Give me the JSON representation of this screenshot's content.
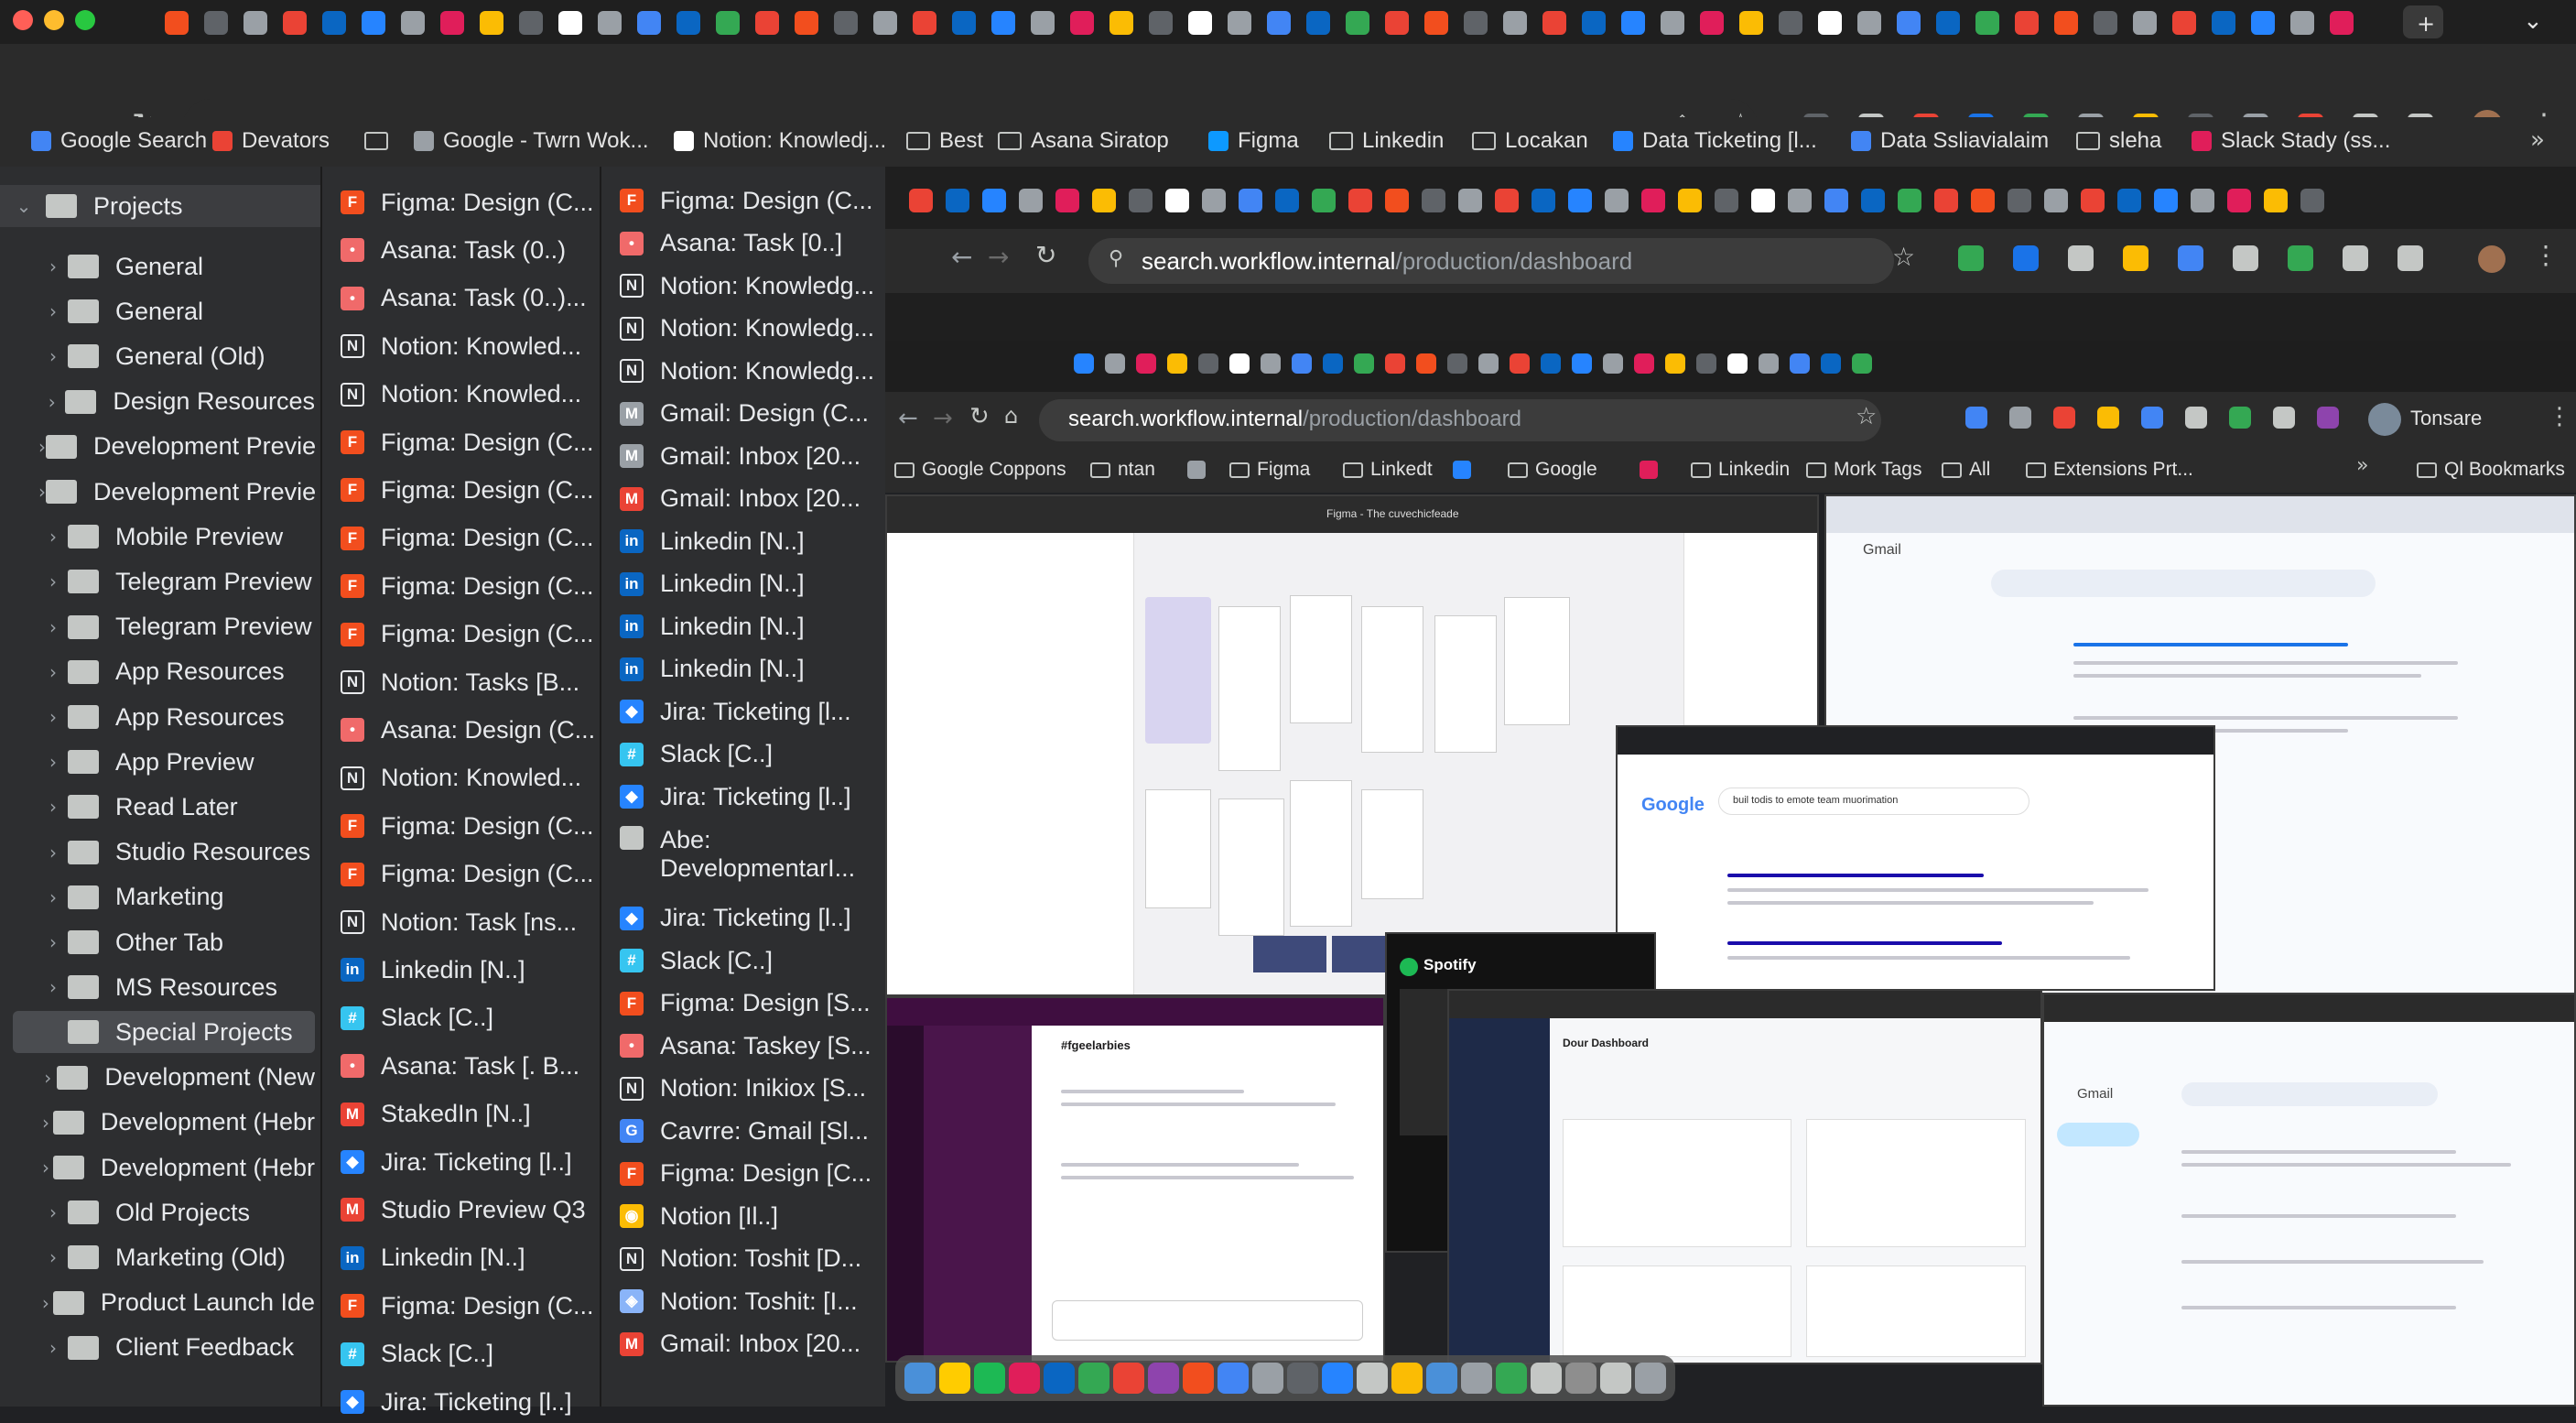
{
  "browser": {
    "address": {
      "host": "search.workflow.internal",
      "path": "/production/dashboard"
    },
    "bookmarks": [
      {
        "label": "Google Search",
        "color": "#4285f4",
        "type": "site"
      },
      {
        "label": "Devators",
        "color": "#ea4335",
        "type": "gmail"
      },
      {
        "label": "",
        "type": "folder"
      },
      {
        "label": "Google - Twrn Wok...",
        "color": "#9aa0a6",
        "type": "site"
      },
      {
        "label": "Notion: Knowledj...",
        "color": "#ffffff",
        "type": "notion"
      },
      {
        "label": "Best",
        "type": "folder"
      },
      {
        "label": "Asana Siratop",
        "type": "folder"
      },
      {
        "label": "Figma",
        "color": "#0d99ff",
        "type": "site"
      },
      {
        "label": "Linkedin",
        "type": "folder"
      },
      {
        "label": "Locakan",
        "type": "folder"
      },
      {
        "label": "Data Ticketing [l...",
        "color": "#2684ff",
        "type": "jira"
      },
      {
        "label": "Data Ssliavialaim",
        "color": "#4285f4",
        "type": "site"
      },
      {
        "label": "sleha",
        "type": "folder"
      },
      {
        "label": "Slack Stady (ss...",
        "color": "#e01e5a",
        "type": "slack"
      }
    ]
  },
  "panel_folders": {
    "header": "Projects",
    "items": [
      "General",
      "General",
      "General (Old)",
      "Design Resources",
      "Development Previe",
      "Development Previe",
      "Mobile Preview",
      "Telegram Preview",
      "Telegram Preview",
      "App Resources",
      "App Resources",
      "App Preview",
      "Read Later",
      "Studio Resources",
      "Marketing",
      "Other Tab",
      "MS Resources",
      "Special Projects",
      "Development (New",
      "Development (Hebr",
      "Development (Hebr",
      "Old Projects",
      "Marketing (Old)",
      "Product Launch Ide",
      "Client Feedback"
    ],
    "selected": "Special Projects"
  },
  "panel_tabs_a": [
    {
      "label": "Figma: Design (C...",
      "icon": "figma"
    },
    {
      "label": "Asana: Task (0..)",
      "icon": "asana"
    },
    {
      "label": "Asana: Task (0..)...",
      "icon": "asana"
    },
    {
      "label": "Notion: Knowled...",
      "icon": "notion"
    },
    {
      "label": "Notion: Knowled...",
      "icon": "notion"
    },
    {
      "label": "Figma: Design (C...",
      "icon": "figma"
    },
    {
      "label": "Figma: Design (C...",
      "icon": "figma"
    },
    {
      "label": "Figma: Design (C...",
      "icon": "figma"
    },
    {
      "label": "Figma: Design (C...",
      "icon": "figma"
    },
    {
      "label": "Figma: Design (C...",
      "icon": "figma"
    },
    {
      "label": "Notion: Tasks [B...",
      "icon": "notion"
    },
    {
      "label": "Asana: Design (C...",
      "icon": "asana"
    },
    {
      "label": "Notion: Knowled...",
      "icon": "notion"
    },
    {
      "label": "Figma: Design (C...",
      "icon": "figma"
    },
    {
      "label": "Figma: Design (C...",
      "icon": "figma"
    },
    {
      "label": "Notion: Task [ns...",
      "icon": "notion"
    },
    {
      "label": "Linkedin [N..]",
      "icon": "linkedin"
    },
    {
      "label": "Slack [C..]",
      "icon": "slack"
    },
    {
      "label": "Asana: Task [. B...",
      "icon": "asana"
    },
    {
      "label": "StakedIn [N..]",
      "icon": "gmail"
    },
    {
      "label": "Jira: Ticketing [l..]",
      "icon": "jira"
    },
    {
      "label": "Studio Preview Q3",
      "icon": "gmail"
    },
    {
      "label": "Linkedin [N..]",
      "icon": "linkedin"
    },
    {
      "label": "Figma: Design (C...",
      "icon": "figma"
    },
    {
      "label": "Slack [C..]",
      "icon": "slack"
    },
    {
      "label": "Jira: Ticketing [l..]",
      "icon": "jira"
    }
  ],
  "panel_tabs_b": [
    {
      "label": "Figma: Design (C...",
      "icon": "figma"
    },
    {
      "label": "Asana: Task [0..]",
      "icon": "asana"
    },
    {
      "label": "Notion: Knowledg...",
      "icon": "notion"
    },
    {
      "label": "Notion: Knowledg...",
      "icon": "notion"
    },
    {
      "label": "Notion: Knowledg...",
      "icon": "notion"
    },
    {
      "label": "Gmail: Design (C...",
      "icon": "gmail-dark"
    },
    {
      "label": "Gmail: Inbox [20...",
      "icon": "gmail-dark"
    },
    {
      "label": "Gmail: Inbox [20...",
      "icon": "gmail"
    },
    {
      "label": "Linkedin [N..]",
      "icon": "linkedin"
    },
    {
      "label": "Linkedin [N..]",
      "icon": "linkedin"
    },
    {
      "label": "Linkedin [N..]",
      "icon": "linkedin"
    },
    {
      "label": "Linkedin [N..]",
      "icon": "linkedin"
    },
    {
      "label": "Jira: Ticketing [l...",
      "icon": "jira"
    },
    {
      "label": "Slack [C..]",
      "icon": "slack"
    },
    {
      "label": "Jira: Ticketing [l..]",
      "icon": "jira"
    },
    {
      "label": "Abe: DevelopmentarI...",
      "icon": "folder"
    },
    {
      "label": "Jira: Ticketing [l..]",
      "icon": "jira"
    },
    {
      "label": "Slack [C..]",
      "icon": "slack"
    },
    {
      "label": "Figma: Design [S...",
      "icon": "figma"
    },
    {
      "label": "Asana: Taskey [S...",
      "icon": "asana"
    },
    {
      "label": "Notion: Inikiox [S...",
      "icon": "notion"
    },
    {
      "label": "Cavrre: Gmail [Sl...",
      "icon": "google"
    },
    {
      "label": "Figma: Design [C...",
      "icon": "figma"
    },
    {
      "label": "Notion [Il..]",
      "icon": "chrome"
    },
    {
      "label": "Notion: Toshit [D...",
      "icon": "notion"
    },
    {
      "label": "Notion: Toshit: [I...",
      "icon": "shield"
    },
    {
      "label": "Gmail: Inbox [20...",
      "icon": "gmail"
    }
  ],
  "inner_window": {
    "bookmarks": [
      "Google Coppons",
      "ntan",
      "",
      "Figma",
      "Linkedt",
      "",
      "Google",
      "",
      "Linkedin",
      "Mork Tags",
      "All",
      "Extensions Prt..."
    ],
    "profile_label": "Tonsare",
    "all_bookmarks": "Ql Bookmarks",
    "mail_label": "Gmail",
    "search_query": "buil todis to emote team muorimation",
    "spotify_label": "Spotify",
    "dashboard_title": "Dour Dashboard",
    "channel": "#fgeelarbies",
    "figma_title": "Figma - The cuvechicfeade"
  },
  "icon_colors": {
    "figma": "#f24e1e",
    "asana": "#f06a6a",
    "notion": "#ffffff",
    "linkedin": "#0a66c2",
    "slack": "#36c5f0",
    "jira": "#2684ff",
    "gmail": "#ea4335",
    "gmail-dark": "#9aa0a6",
    "google": "#4285f4",
    "chrome": "#fbbc04",
    "shield": "#8ab4f8",
    "folder": "#c4c7c5"
  }
}
